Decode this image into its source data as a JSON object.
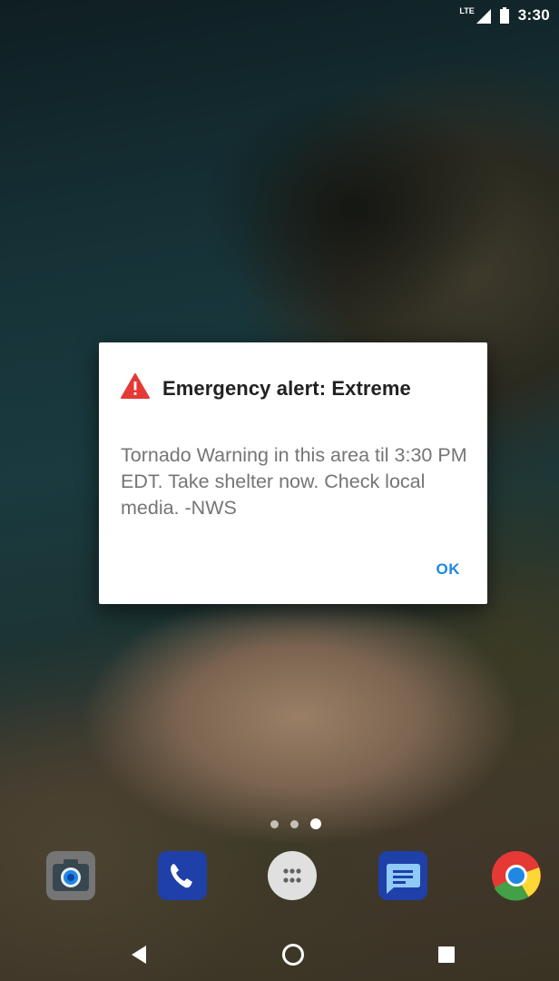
{
  "status_bar": {
    "network_label": "LTE",
    "clock": "3:30",
    "icons": [
      "lte-signal-icon",
      "battery-icon"
    ]
  },
  "alert": {
    "icon": "warning-triangle-icon",
    "icon_color": "#e53935",
    "title": "Emergency alert: Extreme",
    "message": "Tornado Warning in this area til 3:30 PM EDT. Take shelter now. Check local media. -NWS",
    "ok_label": "OK",
    "ok_color": "#1e88e5"
  },
  "home": {
    "page_dots": 3,
    "active_page": 2
  },
  "dock": {
    "apps": [
      {
        "name": "camera-app-icon"
      },
      {
        "name": "phone-app-icon"
      },
      {
        "name": "app-drawer-icon"
      },
      {
        "name": "messages-app-icon"
      },
      {
        "name": "chrome-app-icon"
      }
    ]
  },
  "navigation": {
    "buttons": [
      "back-icon",
      "home-icon",
      "recents-icon"
    ]
  }
}
